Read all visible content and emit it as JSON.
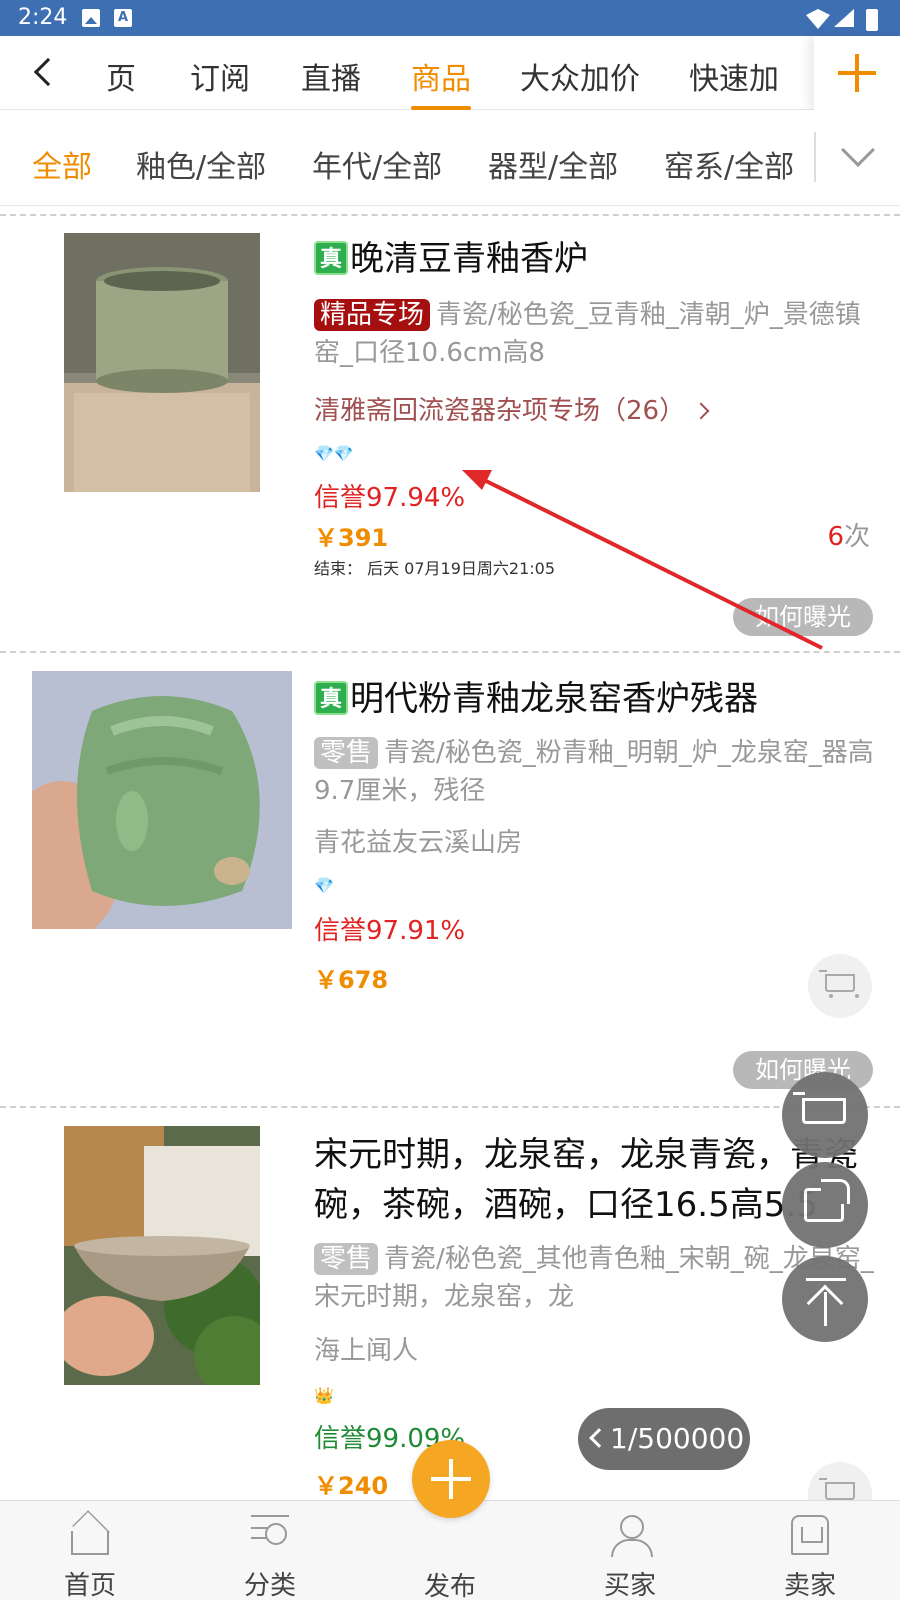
{
  "status_bar": {
    "time": "2:24"
  },
  "top_tabs": [
    "页",
    "订阅",
    "直播",
    "商品",
    "大众加价",
    "快速加"
  ],
  "active_tab": "商品",
  "filters": [
    "全部",
    "釉色/全部",
    "年代/全部",
    "器型/全部",
    "窑系/全部"
  ],
  "active_filter": "全部",
  "items": [
    {
      "verified": "真",
      "title": "晚清豆青釉香炉",
      "tag": "精品专场",
      "desc": "青瓷/秘色瓷_豆青釉_清朝_炉_景德镇窑_口径10.6cm高8",
      "shop": "清雅斋回流瓷器杂项专场（26）",
      "gems": "💎💎",
      "credit": "信誉97.94%",
      "price": "￥391",
      "bids_count": "6",
      "bids_unit": "次",
      "end_time": "结束：  后天 07月19日周六21:05",
      "exposure": "如何曝光"
    },
    {
      "verified": "真",
      "title": "明代粉青釉龙泉窑香炉残器",
      "tag": "零售",
      "desc": "青瓷/秘色瓷_粉青釉_明朝_炉_龙泉窑_器高9.7厘米，残径",
      "shop": "青花益友云溪山房",
      "gems": "💎",
      "credit": "信誉97.91%",
      "price": "￥678",
      "exposure": "如何曝光"
    },
    {
      "title": "宋元时期，龙泉窑，龙泉青瓷，青瓷碗，茶碗，酒碗，口径16.5高5.5",
      "tag": "零售",
      "desc": "青瓷/秘色瓷_其他青色釉_宋朝_碗_龙泉窑_宋元时期，龙泉窑，龙",
      "shop": "海上闻人",
      "gems": "👑",
      "credit": "信誉99.09%",
      "price": "￥240"
    }
  ],
  "pager": "1/500000",
  "bottom_nav": {
    "home": "首页",
    "category": "分类",
    "publish": "发布",
    "buyer": "买家",
    "seller": "卖家"
  },
  "colors": {
    "accent": "#f08c00",
    "status_bar": "#3e6fb3",
    "credit_red": "#e02222",
    "credit_green": "#1e8a33",
    "annotation_arrow": "#e0282a"
  }
}
